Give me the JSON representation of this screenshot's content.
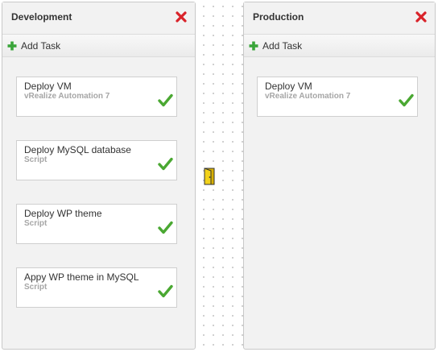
{
  "stages": [
    {
      "title": "Development",
      "add_task_label": "Add Task",
      "tasks": [
        {
          "name": "Deploy VM",
          "type": "vRealize Automation 7"
        },
        {
          "name": "Deploy MySQL database",
          "type": "Script"
        },
        {
          "name": "Deploy WP theme",
          "type": "Script"
        },
        {
          "name": "Appy WP theme in MySQL",
          "type": "Script"
        }
      ]
    },
    {
      "title": "Production",
      "add_task_label": "Add Task",
      "tasks": [
        {
          "name": "Deploy VM",
          "type": "vRealize Automation 7"
        }
      ]
    }
  ],
  "icons": {
    "close": "close-icon",
    "add": "plus-icon",
    "status": "check-icon",
    "gate": "door-icon"
  },
  "colors": {
    "close_red": "#d9232a",
    "check_green": "#4aa832",
    "plus_green": "#3aa53a",
    "gate_yellow": "#f2d21b"
  }
}
